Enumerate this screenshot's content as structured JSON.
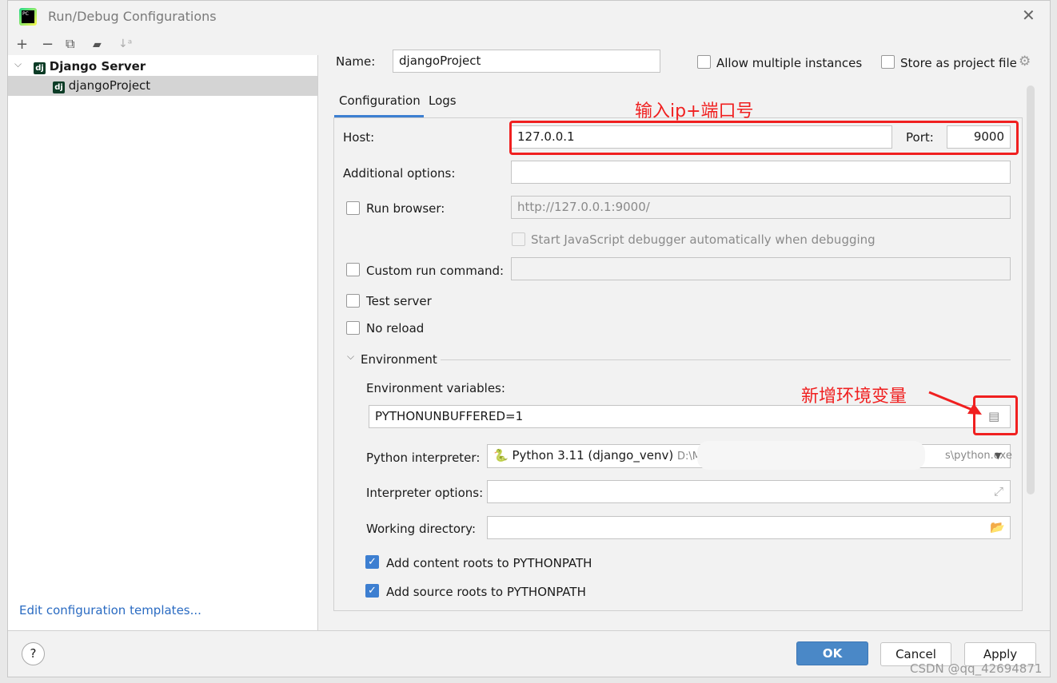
{
  "window": {
    "title": "Run/Debug Configurations"
  },
  "toolbar": {
    "add": "+",
    "remove": "−",
    "copy": "⧉",
    "folder": "▰",
    "sort": "↓ᵃ"
  },
  "tree": {
    "group": "Django Server",
    "item": "djangoProject",
    "icon_text": "dj"
  },
  "left_footer": {
    "link": "Edit configuration templates..."
  },
  "form": {
    "name_label": "Name:",
    "name_value": "djangoProject",
    "allow_multiple": "Allow multiple instances",
    "allow_multiple_checked": false,
    "store_project": "Store as project file",
    "store_project_checked": false,
    "tabs": [
      {
        "label": "Configuration",
        "active": true
      },
      {
        "label": "Logs",
        "active": false
      }
    ],
    "host_label": "Host:",
    "host_value": "127.0.0.1",
    "port_label": "Port:",
    "port_value": "9000",
    "additional_label": "Additional options:",
    "additional_value": "",
    "run_browser_label": "Run browser:",
    "run_browser_checked": false,
    "run_browser_url": "http://127.0.0.1:9000/",
    "js_debugger_label": "Start JavaScript debugger automatically when debugging",
    "custom_run_label": "Custom run command:",
    "test_server_label": "Test server",
    "no_reload_label": "No reload",
    "env_section": "Environment",
    "env_vars_label": "Environment variables:",
    "env_vars_value": "PYTHONUNBUFFERED=1",
    "interpreter_label": "Python interpreter:",
    "interpreter_name": "Python 3.11 (django_venv)",
    "interpreter_path_start": "D:\\M",
    "interpreter_path_end": "s\\python.exe",
    "interp_options_label": "Interpreter options:",
    "working_dir_label": "Working directory:",
    "content_roots_label": "Add content roots to PYTHONPATH",
    "content_roots_checked": true,
    "source_roots_label": "Add source roots to PYTHONPATH",
    "source_roots_checked": true
  },
  "annotations": {
    "ip_port": "输入ip+端口号",
    "env": "新增环境变量"
  },
  "footer": {
    "help": "?",
    "ok": "OK",
    "cancel": "Cancel",
    "apply": "Apply"
  },
  "watermark": "CSDN @qq_42694871",
  "colors": {
    "accent": "#3d7fd1",
    "annotation": "#f02020",
    "ok_button": "#4a88c7"
  }
}
